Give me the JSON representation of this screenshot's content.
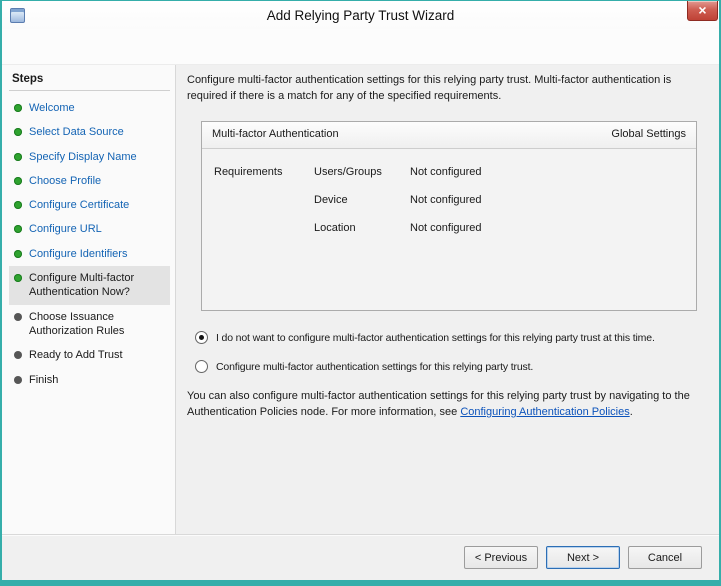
{
  "window": {
    "title": "Add Relying Party Trust Wizard",
    "close_glyph": "×"
  },
  "sidebar": {
    "header": "Steps",
    "steps": [
      {
        "label": "Welcome",
        "state": "done"
      },
      {
        "label": "Select Data Source",
        "state": "done"
      },
      {
        "label": "Specify Display Name",
        "state": "done"
      },
      {
        "label": "Choose Profile",
        "state": "done"
      },
      {
        "label": "Configure Certificate",
        "state": "done"
      },
      {
        "label": "Configure URL",
        "state": "done"
      },
      {
        "label": "Configure Identifiers",
        "state": "done"
      },
      {
        "label": "Configure Multi-factor Authentication Now?",
        "state": "current"
      },
      {
        "label": "Choose Issuance Authorization Rules",
        "state": "pending"
      },
      {
        "label": "Ready to Add Trust",
        "state": "pending"
      },
      {
        "label": "Finish",
        "state": "pending"
      }
    ]
  },
  "main": {
    "intro": "Configure multi-factor authentication settings for this relying party trust. Multi-factor authentication is required if there is a match for any of the specified requirements.",
    "panel": {
      "title": "Multi-factor Authentication",
      "right_label": "Global Settings",
      "section_label": "Requirements",
      "rows": [
        {
          "name": "Users/Groups",
          "value": "Not configured"
        },
        {
          "name": "Device",
          "value": "Not configured"
        },
        {
          "name": "Location",
          "value": "Not configured"
        }
      ]
    },
    "options": [
      {
        "label": "I do not want to configure multi-factor authentication settings for this relying party trust at this time.",
        "selected": true
      },
      {
        "label": "Configure multi-factor authentication settings for this relying party trust.",
        "selected": false
      }
    ],
    "note": {
      "before": "You can also configure multi-factor authentication settings for this relying party trust by navigating to the Authentication Policies node. For more information, see ",
      "link": "Configuring Authentication Policies",
      "after": "."
    }
  },
  "footer": {
    "previous": "< Previous",
    "next": "Next >",
    "cancel": "Cancel"
  },
  "colors": {
    "frame_teal": "#35aeaa",
    "step_link_blue": "#1464b4",
    "bullet_green": "#2fa32f",
    "bullet_gray": "#565656",
    "link_blue": "#0c53bb",
    "close_red": "#bf4236"
  }
}
